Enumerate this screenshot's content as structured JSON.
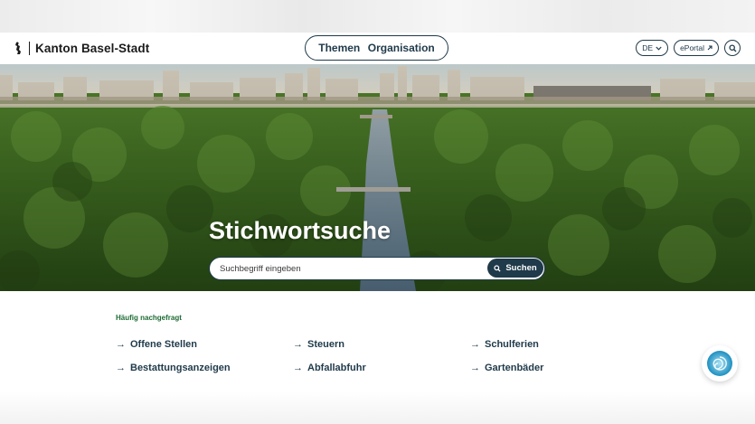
{
  "header": {
    "logo_text": "Kanton Basel-Stadt",
    "nav": [
      "Themen",
      "Organisation"
    ],
    "language": "DE",
    "eportal": "ePortal"
  },
  "hero": {
    "title": "Stichwortsuche",
    "search_placeholder": "Suchbegriff eingeben",
    "search_button": "Suchen"
  },
  "faq": {
    "label": "Häufig nachgefragt",
    "links": [
      "Offene Stellen",
      "Steuern",
      "Schulferien",
      "Bestattungsanzeigen",
      "Abfallabfuhr",
      "Gartenbäder"
    ]
  },
  "icons": {
    "logo": "basilisk-staff-icon",
    "language_caret": "chevron-down-icon",
    "external": "external-link-icon",
    "search": "search-icon",
    "chat": "chatbot-icon"
  },
  "colors": {
    "primary": "#1f3a4a",
    "accent_green": "#1e6b34",
    "white": "#ffffff"
  }
}
